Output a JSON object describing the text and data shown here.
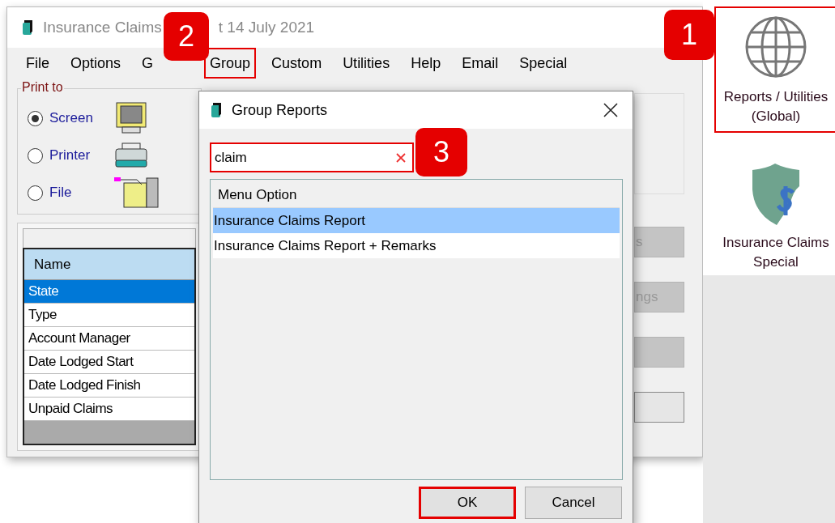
{
  "main_window": {
    "title_parts": [
      "Insurance Claims",
      "t 14 July 2021"
    ],
    "menu": [
      {
        "label": "File",
        "highlighted": false
      },
      {
        "label": "Options",
        "highlighted": false
      },
      {
        "label": "G",
        "highlighted": false
      },
      {
        "label": "Group",
        "highlighted": true
      },
      {
        "label": "Custom",
        "highlighted": false
      },
      {
        "label": "Utilities",
        "highlighted": false
      },
      {
        "label": "Help",
        "highlighted": false
      },
      {
        "label": "Email",
        "highlighted": false
      },
      {
        "label": "Special",
        "highlighted": false
      }
    ],
    "print_to": {
      "label": "Print to",
      "options": [
        {
          "label": "Screen",
          "selected": true,
          "kind": "monitor"
        },
        {
          "label": "Printer",
          "selected": false,
          "kind": "printer"
        },
        {
          "label": "File",
          "selected": false,
          "kind": "cabinet"
        }
      ]
    },
    "parameters": {
      "column": "Name",
      "rows": [
        {
          "label": "State",
          "selected": true
        },
        {
          "label": "Type",
          "selected": false
        },
        {
          "label": "Account Manager",
          "selected": false
        },
        {
          "label": "Date Lodged Start",
          "selected": false
        },
        {
          "label": "Date Lodged Finish",
          "selected": false
        },
        {
          "label": "Unpaid Claims",
          "selected": false
        }
      ]
    },
    "side_buttons": [
      {
        "label": "s",
        "disabled": true
      },
      {
        "label": "ngs",
        "disabled": true
      },
      {
        "disabled": true
      },
      {
        "disabled": false
      }
    ]
  },
  "launcher": [
    {
      "label": "Reports / Utilities (Global)",
      "kind": "globe",
      "highlighted": true
    },
    {
      "label": "Insurance Claims Special",
      "kind": "shield",
      "highlighted": false
    }
  ],
  "dialog": {
    "title": "Group Reports",
    "search": {
      "value": "claim"
    },
    "column": "Menu Option",
    "rows": [
      {
        "label": "Insurance Claims Report",
        "selected": true
      },
      {
        "label": "Insurance Claims Report + Remarks",
        "selected": false
      }
    ],
    "buttons": [
      {
        "label": "OK",
        "highlighted": true
      },
      {
        "label": "Cancel",
        "highlighted": false
      }
    ]
  },
  "callouts": [
    "1",
    "2",
    "3"
  ]
}
